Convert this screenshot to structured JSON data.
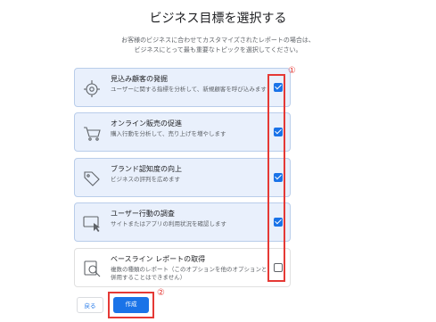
{
  "page": {
    "title": "ビジネス目標を選択する",
    "description_lines": [
      "お客様のビジネスに合わせてカスタマイズされたレポートの場合は、",
      "ビジネスにとって最も重要なトピックを選択してください。"
    ]
  },
  "goals": [
    {
      "title": "見込み顧客の発掘",
      "description": "ユーザーに関する指標を分析して、新規顧客を呼び込みます",
      "checked": true,
      "icon": "target-icon"
    },
    {
      "title": "オンライン販売の促進",
      "description": "購入行動を分析して、売り上げを増やします",
      "checked": true,
      "icon": "cart-icon"
    },
    {
      "title": "ブランド認知度の向上",
      "description": "ビジネスの評判を広めます",
      "checked": true,
      "icon": "tag-icon"
    },
    {
      "title": "ユーザー行動の調査",
      "description": "サイトまたはアプリの利用状況を確認します",
      "checked": true,
      "icon": "screen-cursor-icon"
    },
    {
      "title": "ベースライン レポートの取得",
      "description": "複数の種類のレポート（このオプションを他のオプションと併用することはできません）",
      "checked": false,
      "icon": "report-search-icon"
    }
  ],
  "annotations": {
    "marker1": "①",
    "marker2": "②",
    "color": "#e53935"
  },
  "buttons": {
    "back_label": "戻る",
    "create_label": "作成"
  },
  "colors": {
    "accent": "#1a73e8",
    "selected_card_bg": "#e9f0fc"
  }
}
